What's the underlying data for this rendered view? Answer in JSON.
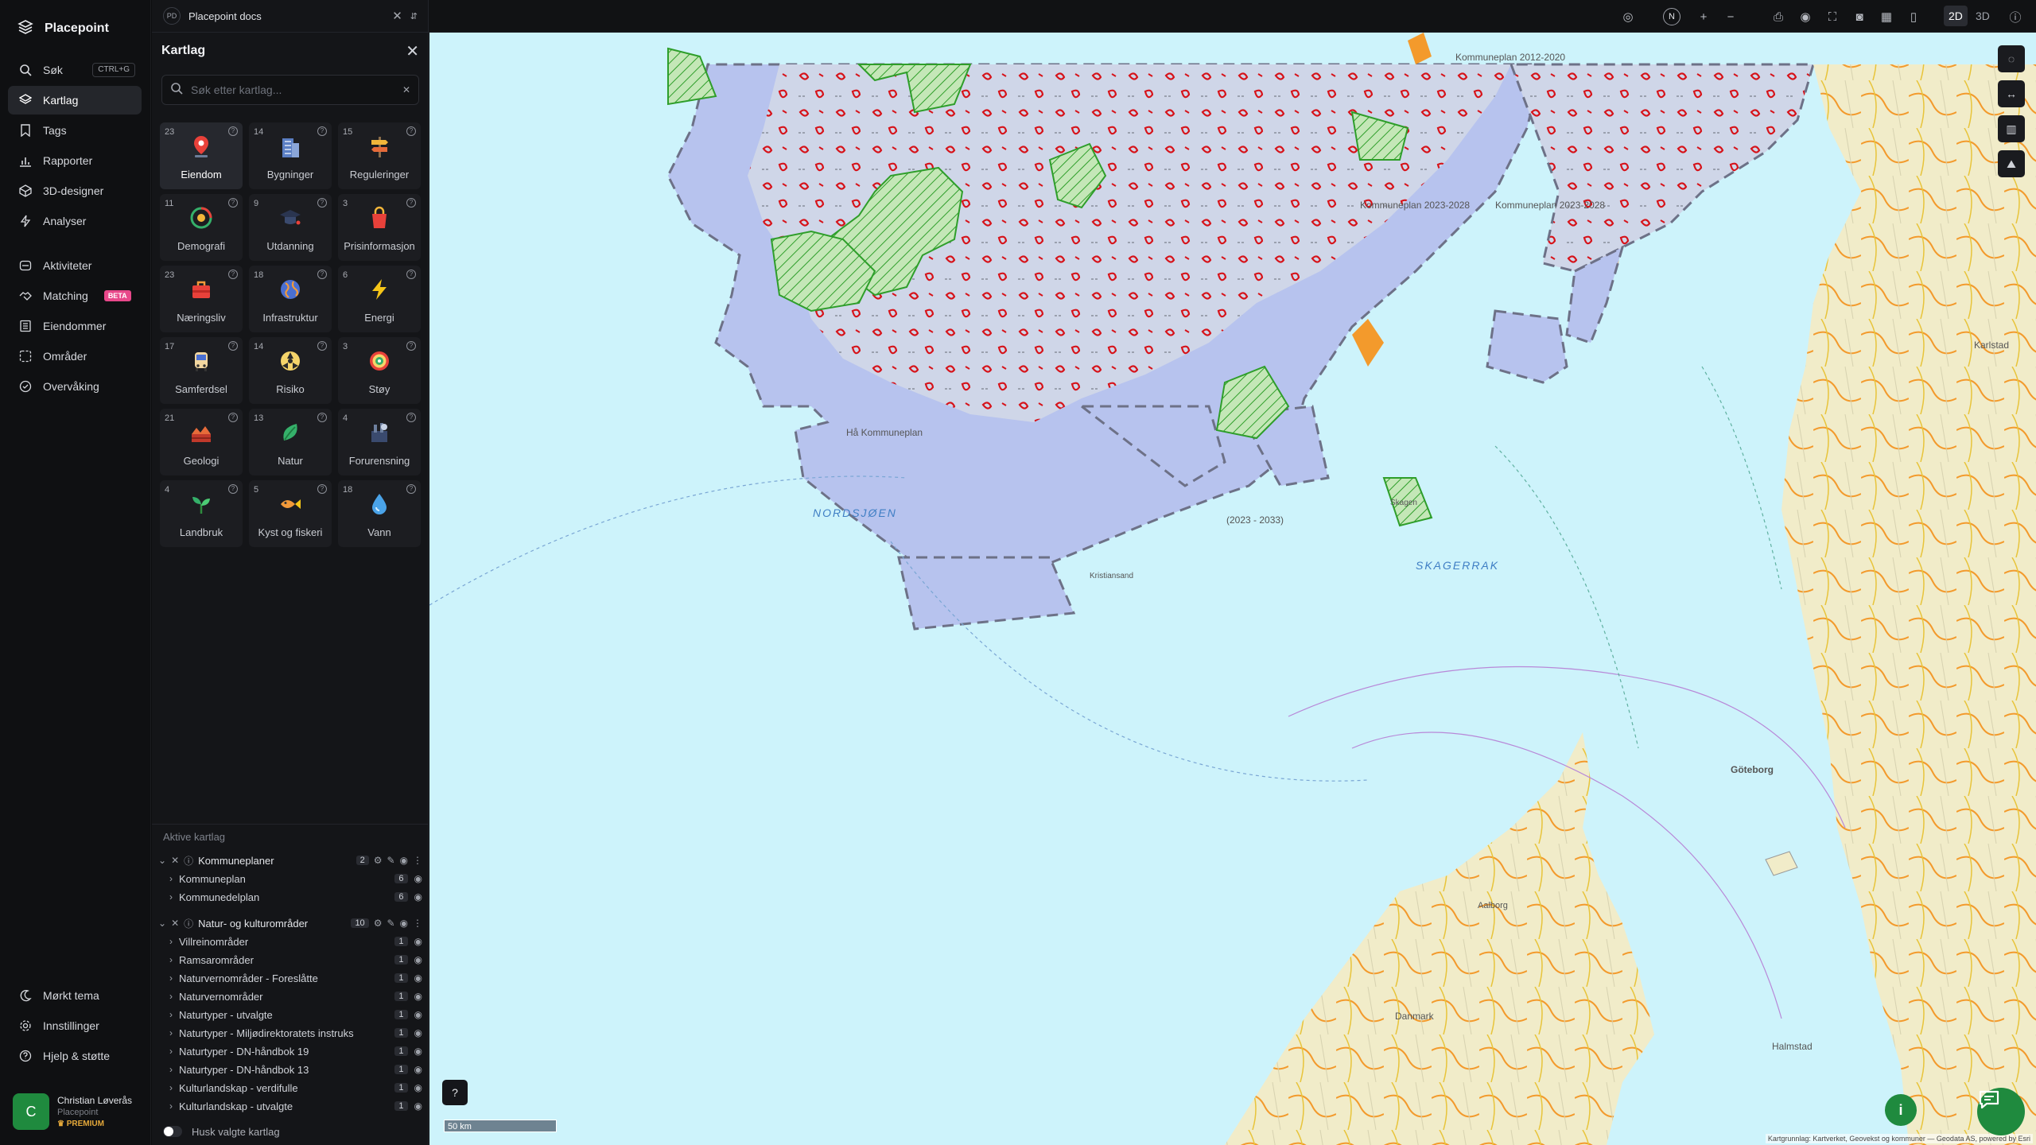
{
  "nav": {
    "brand": "Placepoint",
    "items": [
      {
        "label": "Søk",
        "shortcut": "CTRL+G",
        "icon": "search-icon"
      },
      {
        "label": "Kartlag",
        "icon": "layers-icon"
      },
      {
        "label": "Tags",
        "icon": "bookmark-icon"
      },
      {
        "label": "Rapporter",
        "icon": "bar-chart-icon"
      },
      {
        "label": "3D-designer",
        "icon": "cube-icon"
      },
      {
        "label": "Analyser",
        "icon": "bolt-icon"
      },
      {
        "label": "Aktiviteter",
        "icon": "activity-icon"
      },
      {
        "label": "Matching",
        "badge": "BETA",
        "icon": "handshake-icon"
      },
      {
        "label": "Eiendommer",
        "icon": "building-icon"
      },
      {
        "label": "Områder",
        "icon": "area-icon"
      },
      {
        "label": "Overvåking",
        "icon": "monitor-icon"
      }
    ],
    "footer": [
      {
        "label": "Mørkt tema",
        "icon": "moon-icon"
      },
      {
        "label": "Innstillinger",
        "icon": "gear-icon"
      },
      {
        "label": "Hjelp & støtte",
        "icon": "help-icon"
      }
    ],
    "user": {
      "initial": "C",
      "name": "Christian Løverås",
      "org": "Placepoint",
      "plan": "PREMIUM"
    }
  },
  "panel": {
    "doc_badge": "PD",
    "doc_title": "Placepoint docs",
    "title": "Kartlag",
    "search_placeholder": "Søk etter kartlag...",
    "categories": [
      {
        "count": "23",
        "label": "Eiendom",
        "icon": "pin-icon"
      },
      {
        "count": "14",
        "label": "Bygninger",
        "icon": "buildings-icon"
      },
      {
        "count": "15",
        "label": "Reguleringer",
        "icon": "signpost-icon"
      },
      {
        "count": "11",
        "label": "Demografi",
        "icon": "age-icon"
      },
      {
        "count": "9",
        "label": "Utdanning",
        "icon": "graduation-icon"
      },
      {
        "count": "3",
        "label": "Prisinformasjon",
        "icon": "shopping-bag-icon"
      },
      {
        "count": "23",
        "label": "Næringsliv",
        "icon": "briefcase-icon"
      },
      {
        "count": "18",
        "label": "Infrastruktur",
        "icon": "globe-icon"
      },
      {
        "count": "6",
        "label": "Energi",
        "icon": "lightning-icon"
      },
      {
        "count": "17",
        "label": "Samferdsel",
        "icon": "bus-icon"
      },
      {
        "count": "14",
        "label": "Risiko",
        "icon": "hazard-icon"
      },
      {
        "count": "3",
        "label": "Støy",
        "icon": "noise-icon"
      },
      {
        "count": "21",
        "label": "Geologi",
        "icon": "geology-icon"
      },
      {
        "count": "13",
        "label": "Natur",
        "icon": "leaf-icon"
      },
      {
        "count": "4",
        "label": "Forurensning",
        "icon": "factory-icon"
      },
      {
        "count": "4",
        "label": "Landbruk",
        "icon": "sprout-icon"
      },
      {
        "count": "5",
        "label": "Kyst og fiskeri",
        "icon": "fish-icon"
      },
      {
        "count": "18",
        "label": "Vann",
        "icon": "droplet-icon"
      }
    ],
    "active_title": "Aktive kartlag",
    "groups": [
      {
        "label": "Kommuneplaner",
        "count": "2",
        "children": [
          {
            "label": "Kommuneplan",
            "count": "6"
          },
          {
            "label": "Kommunedelplan",
            "count": "6"
          }
        ]
      },
      {
        "label": "Natur- og kulturområder",
        "count": "10",
        "children": [
          {
            "label": "Villreinområder",
            "count": "1"
          },
          {
            "label": "Ramsarområder",
            "count": "1"
          },
          {
            "label": "Naturvernområder - Foreslåtte",
            "count": "1"
          },
          {
            "label": "Naturvernområder",
            "count": "1"
          },
          {
            "label": "Naturtyper - utvalgte",
            "count": "1"
          },
          {
            "label": "Naturtyper - Miljødirektoratets instruks",
            "count": "1"
          },
          {
            "label": "Naturtyper - DN-håndbok 19",
            "count": "1"
          },
          {
            "label": "Naturtyper - DN-håndbok 13",
            "count": "1"
          },
          {
            "label": "Kulturlandskap - verdifulle",
            "count": "1"
          },
          {
            "label": "Kulturlandskap - utvalgte",
            "count": "1"
          }
        ]
      }
    ],
    "remember_label": "Husk valgte kartlag"
  },
  "topbar": {
    "compass": "N",
    "mode_2d": "2D",
    "mode_3d": "3D"
  },
  "map": {
    "sea_labels": [
      "NORDSJØEN",
      "SKAGERRAK"
    ],
    "places": [
      "Hå Kommuneplan",
      "Kristiansand",
      "Danmark",
      "Göteborg",
      "Halmstad",
      "Karlstad",
      "Skagen",
      "Aalborg"
    ],
    "plan_labels": [
      "Kommuneplan 2012-2020",
      "Kommuneplan 2023-2028",
      "(2023 - 2033)",
      "Kommuneplan 2023-2028"
    ],
    "scale": "50 km",
    "attribution": "Kartgrunnlag: Kartverket, Geovekst og kommuner — Geodata AS, powered by Esri"
  },
  "colors": {
    "accent": "#1f8a3e",
    "sea": "#cdf3fb",
    "land": "#d8d2c4",
    "plan_fill": "#b7c3ee",
    "nature_green": "#2e9e2a",
    "red_areas": "#d6131a"
  }
}
